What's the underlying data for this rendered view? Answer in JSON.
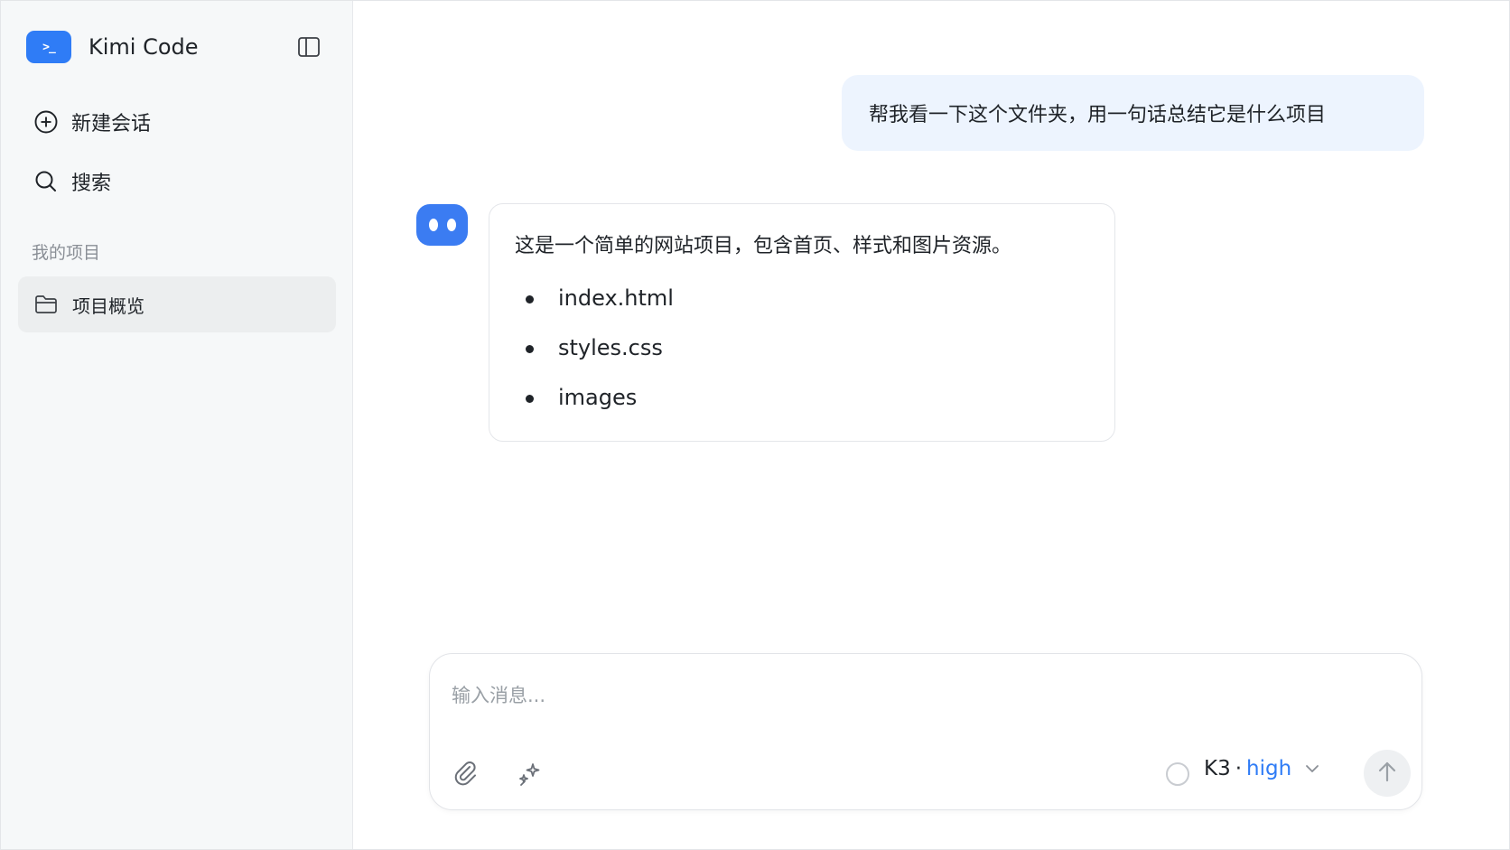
{
  "sidebar": {
    "brand": {
      "logo_text": ">_",
      "name": "Kimi Code",
      "accent": "#2f7cf6"
    },
    "nav": {
      "new_chat": "新建会话",
      "search": "搜索"
    },
    "section_title": "我的项目",
    "projects": [
      {
        "label": "项目概览",
        "selected": true
      }
    ]
  },
  "chat": {
    "user_message": "帮我看一下这个文件夹，用一句话总结它是什么项目",
    "assistant": {
      "text": "这是一个简单的网站项目，包含首页、样式和图片资源。",
      "items": [
        "index.html",
        "styles.css",
        "images"
      ]
    }
  },
  "composer": {
    "placeholder": "输入消息...",
    "model": {
      "name": "K3",
      "separator": "·",
      "level": "high"
    }
  },
  "icons": {
    "sidebar_toggle": "sidebar-toggle-icon",
    "new_chat": "plus-circle-icon",
    "search": "search-icon",
    "project": "folder-icon",
    "attach": "paperclip-icon",
    "magic": "sparkle-icon",
    "status": "circle-icon",
    "chevron": "chevron-down-icon",
    "send": "arrow-up-icon"
  }
}
